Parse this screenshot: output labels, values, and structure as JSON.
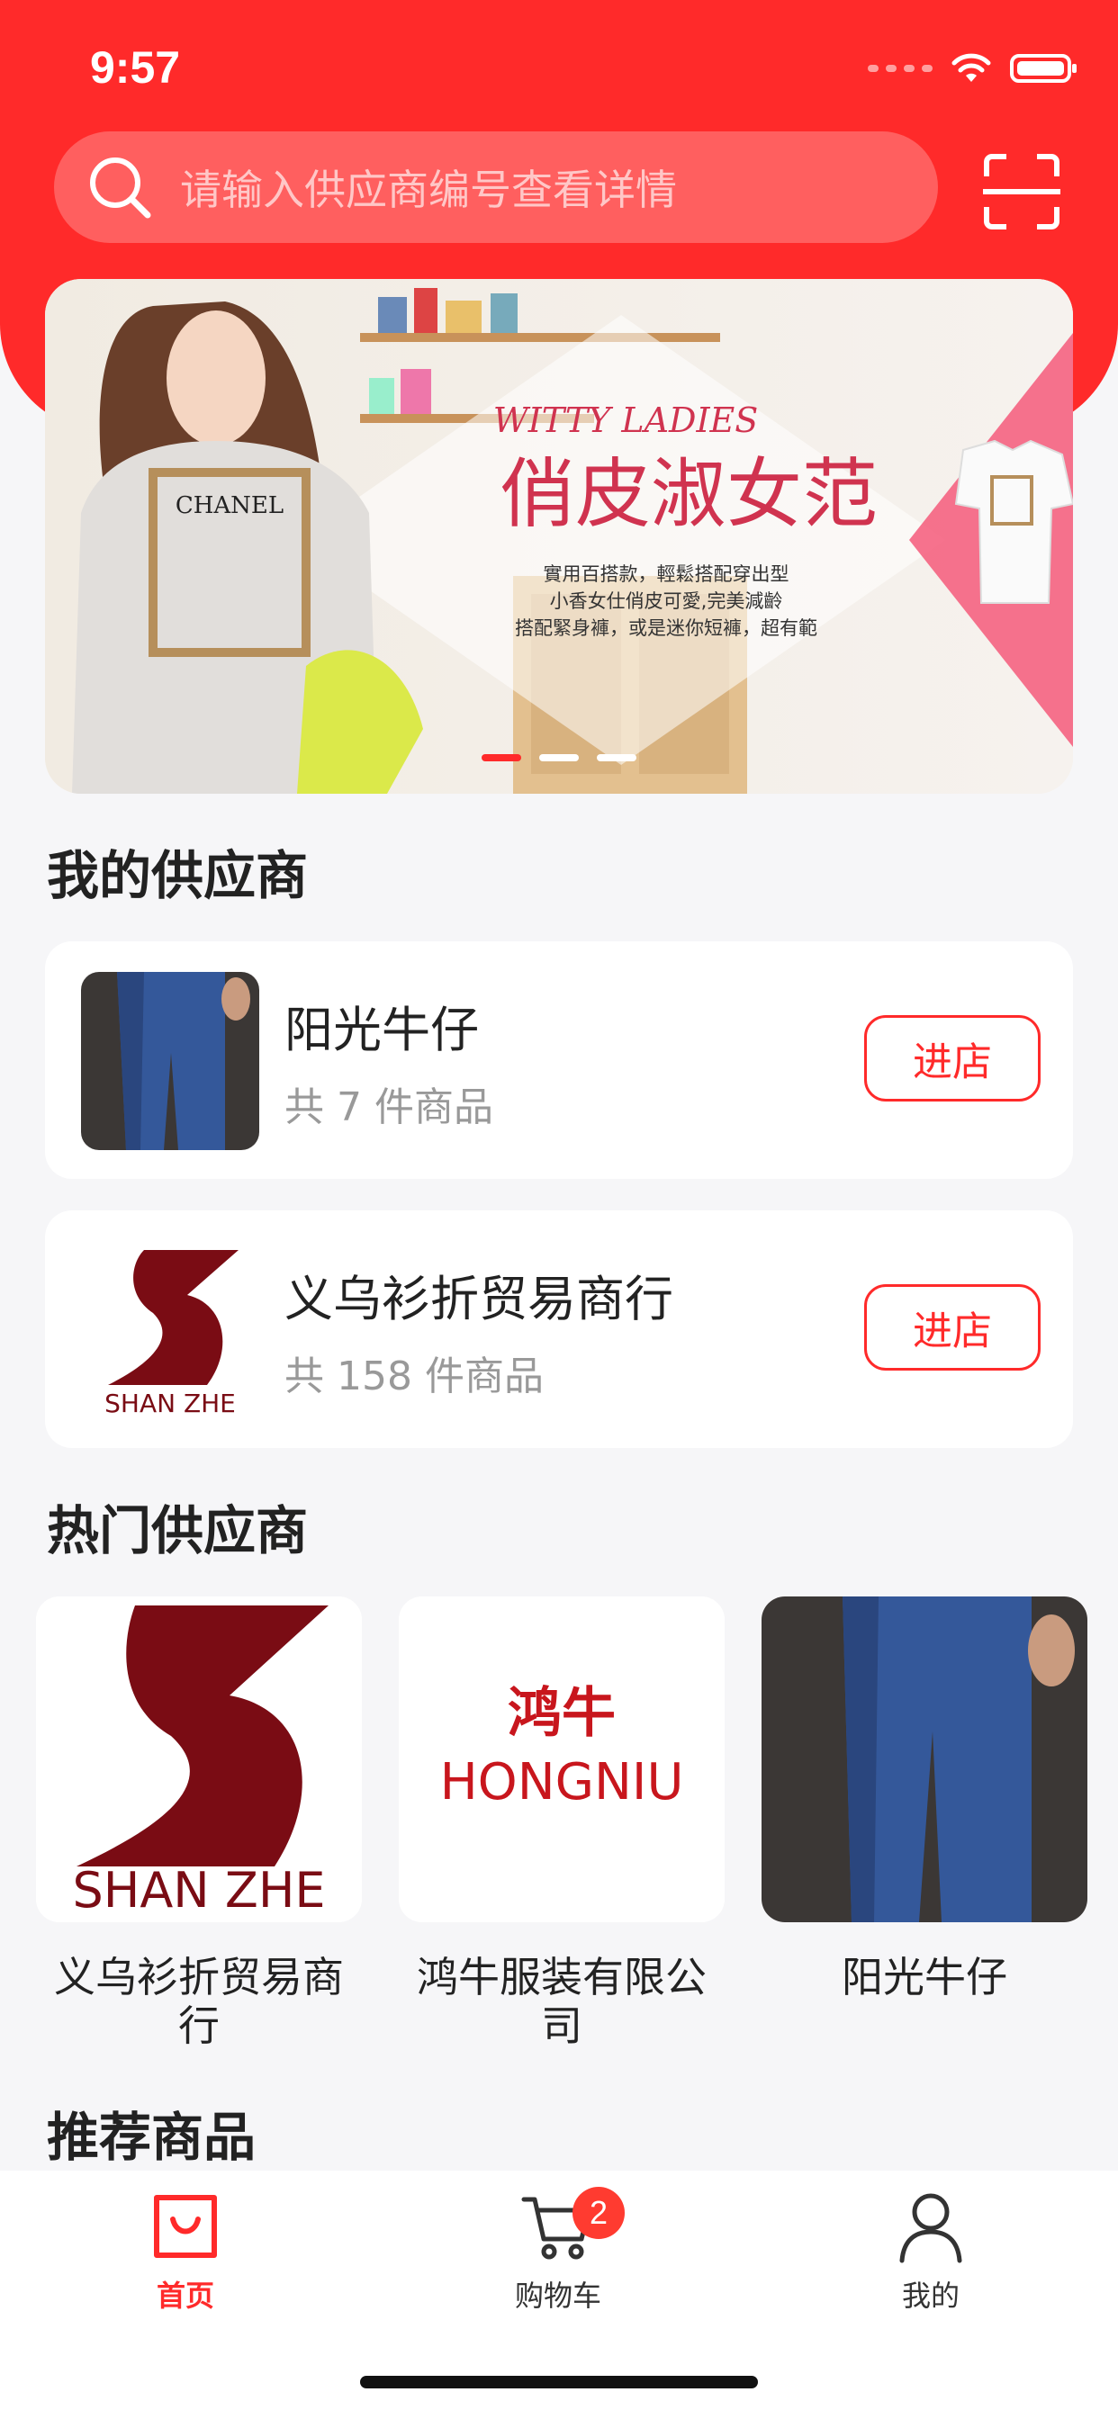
{
  "status_bar": {
    "time": "9:57"
  },
  "search": {
    "placeholder": "请输入供应商编号查看详情"
  },
  "banner": {
    "title_en": "WITTY LADIES",
    "title_cn": "俏皮淑女范",
    "desc_lines": [
      "實用百搭款，輕鬆搭配穿出型",
      "小香女仕俏皮可愛,完美減齡",
      "搭配緊身褲，或是迷你短褲，超有範"
    ],
    "shirt_text": "CHANEL",
    "active_dot": 0
  },
  "my_suppliers": {
    "title": "我的供应商",
    "items": [
      {
        "name": "阳光牛仔",
        "count": "共 7 件商品",
        "button": "进店",
        "thumb": "jeans"
      },
      {
        "name": "义乌衫折贸易商行",
        "count": "共 158 件商品",
        "button": "进店",
        "thumb": "shanzhe-logo",
        "logo_text": "SHAN ZHE"
      }
    ]
  },
  "hot_suppliers": {
    "title": "热门供应商",
    "items": [
      {
        "name": "义乌衫折贸易商行",
        "thumb": "shanzhe-logo",
        "logo_text": "SHAN ZHE"
      },
      {
        "name": "鸿牛服装有限公司",
        "thumb": "hongniu-logo",
        "logo_cn": "鸿牛",
        "logo_en": "HONGNIU"
      },
      {
        "name": "阳光牛仔",
        "thumb": "jeans"
      }
    ]
  },
  "recommend": {
    "title": "推荐商品"
  },
  "tabbar": {
    "tabs": [
      {
        "label": "首页",
        "icon": "shopping-bag-icon",
        "active": true
      },
      {
        "label": "购物车",
        "icon": "cart-icon",
        "badge": "2"
      },
      {
        "label": "我的",
        "icon": "user-icon"
      }
    ]
  },
  "colors": {
    "brand": "#ff2a2a",
    "badge": "#ff3b30"
  }
}
